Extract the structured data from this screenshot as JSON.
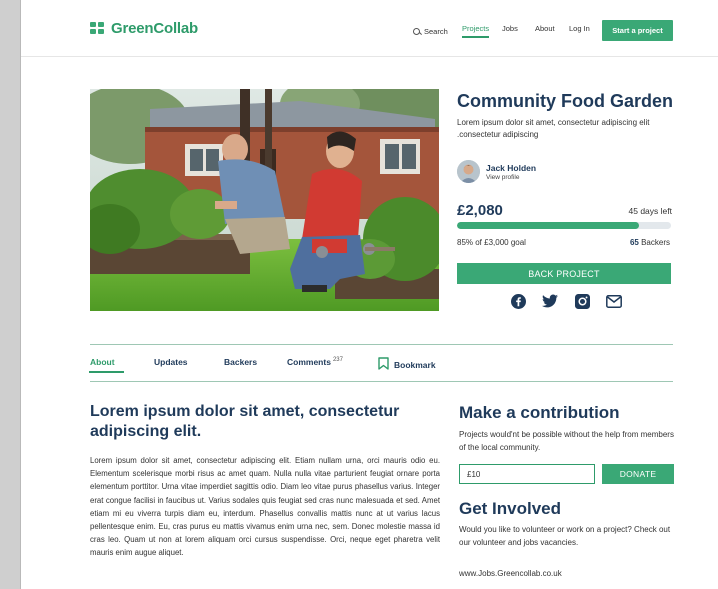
{
  "brand": {
    "name": "GreenCollab",
    "accent": "#3aa876",
    "heading_color": "#1f3a5a"
  },
  "nav": {
    "search": "Search",
    "projects": "Projects",
    "jobs": "Jobs",
    "about": "About",
    "login": "Log In",
    "cta": "Start a project"
  },
  "project": {
    "title": "Community Food Garden",
    "description": "Lorem ipsum dolor sit amet, consectetur adipiscing elit .consectetur adipiscing",
    "creator_name": "Jack Holden",
    "creator_link": "View profile",
    "raised": "£2,080",
    "days_left": "45 days left",
    "progress_percent": 85,
    "goal_text": "85% of £3,000 goal",
    "backers_count": "65",
    "backers_label": " Backers",
    "back_button": "BACK PROJECT",
    "social_icons": [
      "facebook-icon",
      "twitter-icon",
      "instagram-icon",
      "mail-icon"
    ]
  },
  "tabs": {
    "about": "About",
    "updates": "Updates",
    "backers": "Backers",
    "comments": "Comments",
    "comments_count": "237",
    "bookmark": "Bookmark"
  },
  "article": {
    "title": "Lorem ipsum dolor sit amet, consectetur adipiscing elit.",
    "body": "Lorem ipsum dolor sit amet, consectetur adipiscing elit. Etiam nullam urna, orci mauris odio eu. Elementum scelerisque morbi risus ac amet quam. Nulla nulla vitae parturient feugiat ornare porta elementum porttitor. Urna vitae imperdiet sagittis odio. Diam leo vitae purus phasellus varius. Integer erat congue facilisi in faucibus ut. Varius sodales quis feugiat sed cras nunc malesuada et sed. Amet etiam mi eu viverra turpis diam eu, interdum. Phasellus convallis mattis nunc at ut varius lacus pellentesque enim. Eu, cras purus eu mattis vivamus enim urna nec, sem. Donec molestie massa id cras leo. Quam ut non at lorem aliquam orci cursus suspendisse. Orci, neque eget pharetra velit mauris enim augue aliquet."
  },
  "contribution": {
    "title": "Make a contribution",
    "text": "Projects would'nt be possible without the help from members of the local community.",
    "amount_value": "£10",
    "donate": "DONATE"
  },
  "involved": {
    "title": "Get Involved",
    "text": "Would you like to volunteer or work on a project? Check out our volunteer and jobs vacancies.",
    "link": "www.Jobs.Greencollab.co.uk"
  }
}
